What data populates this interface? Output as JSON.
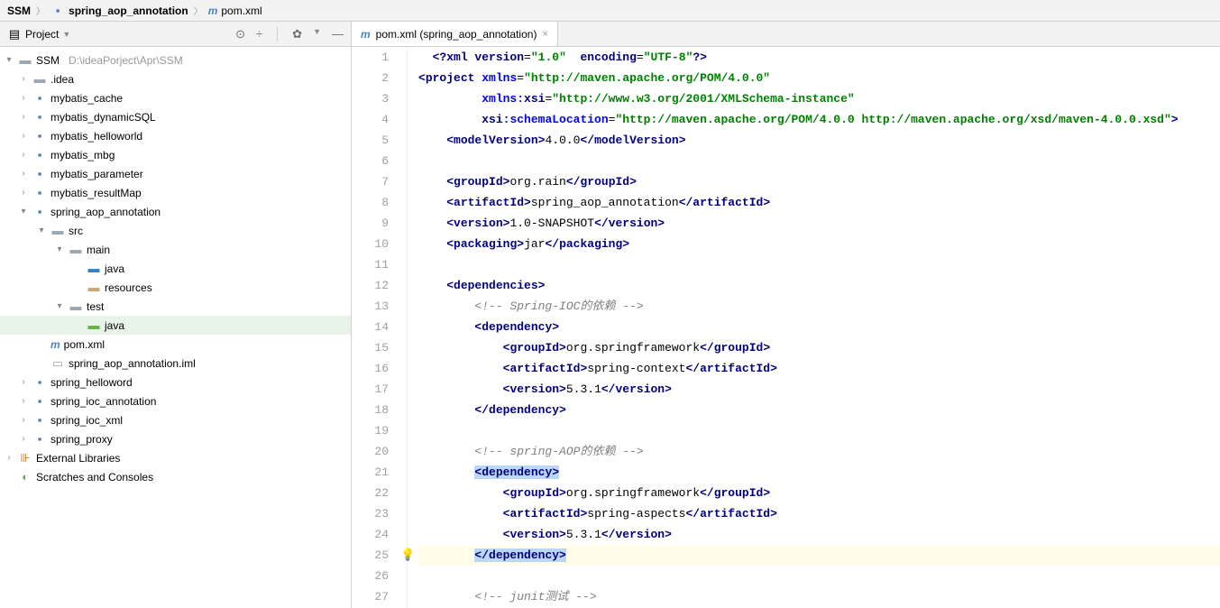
{
  "breadcrumb": {
    "root": "SSM",
    "module": "spring_aop_annotation",
    "file": "pom.xml"
  },
  "projectPanel": {
    "title": "Project"
  },
  "tree": {
    "root": "SSM",
    "rootPath": "D:\\ideaPorject\\Apr\\SSM",
    "nodes": [
      ".idea",
      "mybatis_cache",
      "mybatis_dynamicSQL",
      "mybatis_helloworld",
      "mybatis_mbg",
      "mybatis_parameter",
      "mybatis_resultMap",
      "spring_aop_annotation",
      "src",
      "main",
      "java",
      "resources",
      "test",
      "java",
      "pom.xml",
      "spring_aop_annotation.iml",
      "spring_helloword",
      "spring_ioc_annotation",
      "spring_ioc_xml",
      "spring_proxy",
      "External Libraries",
      "Scratches and Consoles"
    ]
  },
  "tab": {
    "label": "pom.xml (spring_aop_annotation)"
  },
  "lineNumbers": [
    "1",
    "2",
    "3",
    "4",
    "5",
    "6",
    "7",
    "8",
    "9",
    "10",
    "11",
    "12",
    "13",
    "14",
    "15",
    "16",
    "17",
    "18",
    "19",
    "20",
    "21",
    "22",
    "23",
    "24",
    "25",
    "26",
    "27"
  ],
  "code": {
    "l1a": "<?",
    "l1b": "xml version",
    "l1c": "=",
    "l1d": "\"1.0\"",
    "l1e": "encoding",
    "l1f": "=",
    "l1g": "\"UTF-8\"",
    "l1h": "?>",
    "l2a": "<",
    "l2b": "project ",
    "l2c": "xmlns",
    "l2d": "=",
    "l2e": "\"http://maven.apache.org/POM/4.0.0\"",
    "l3a": "xmlns:",
    "l3b": "xsi",
    "l3c": "=",
    "l3d": "\"http://www.w3.org/2001/XMLSchema-instance\"",
    "l4a": "xsi",
    "l4b": ":",
    "l4c": "schemaLocation",
    "l4d": "=",
    "l4e": "\"http://maven.apache.org/POM/4.0.0 http://maven.apache.org/xsd/maven-4.0.0.xsd\"",
    "l4f": ">",
    "l5a": "<",
    "l5b": "modelVersion",
    "l5c": ">",
    "l5d": "4.0.0",
    "l5e": "</",
    "l5f": "modelVersion",
    "l5g": ">",
    "l7a": "<",
    "l7b": "groupId",
    "l7c": ">",
    "l7d": "org.rain",
    "l7e": "</",
    "l7f": "groupId",
    "l7g": ">",
    "l8a": "<",
    "l8b": "artifactId",
    "l8c": ">",
    "l8d": "spring_aop_annotation",
    "l8e": "</",
    "l8f": "artifactId",
    "l8g": ">",
    "l9a": "<",
    "l9b": "version",
    "l9c": ">",
    "l9d": "1.0-SNAPSHOT",
    "l9e": "</",
    "l9f": "version",
    "l9g": ">",
    "l10a": "<",
    "l10b": "packaging",
    "l10c": ">",
    "l10d": "jar",
    "l10e": "</",
    "l10f": "packaging",
    "l10g": ">",
    "l12a": "<",
    "l12b": "dependencies",
    "l12c": ">",
    "l13": "<!-- Spring-IOC的依赖 -->",
    "l14a": "<",
    "l14b": "dependency",
    "l14c": ">",
    "l15a": "<",
    "l15b": "groupId",
    "l15c": ">",
    "l15d": "org.springframework",
    "l15e": "</",
    "l15f": "groupId",
    "l15g": ">",
    "l16a": "<",
    "l16b": "artifactId",
    "l16c": ">",
    "l16d": "spring-context",
    "l16e": "</",
    "l16f": "artifactId",
    "l16g": ">",
    "l17a": "<",
    "l17b": "version",
    "l17c": ">",
    "l17d": "5.3.1",
    "l17e": "</",
    "l17f": "version",
    "l17g": ">",
    "l18a": "</",
    "l18b": "dependency",
    "l18c": ">",
    "l20": "<!-- spring-AOP的依赖 -->",
    "l21a": "<",
    "l21b": "dependency",
    "l21c": ">",
    "l22a": "<",
    "l22b": "groupId",
    "l22c": ">",
    "l22d": "org.springframework",
    "l22e": "</",
    "l22f": "groupId",
    "l22g": ">",
    "l23a": "<",
    "l23b": "artifactId",
    "l23c": ">",
    "l23d": "spring-aspects",
    "l23e": "</",
    "l23f": "artifactId",
    "l23g": ">",
    "l24a": "<",
    "l24b": "version",
    "l24c": ">",
    "l24d": "5.3.1",
    "l24e": "</",
    "l24f": "version",
    "l24g": ">",
    "l25a": "</",
    "l25b": "dependency",
    "l25c": ">",
    "l27": "<!-- junit测试 -->"
  }
}
